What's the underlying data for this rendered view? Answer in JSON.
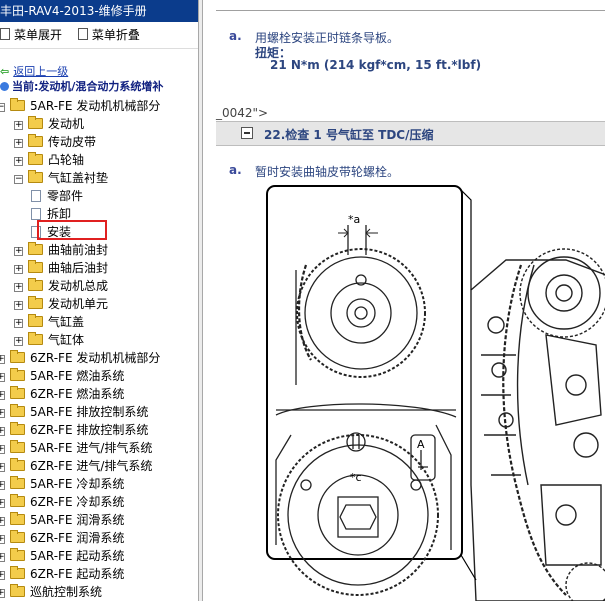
{
  "window_title": "丰田-RAV4-2013-维修手册",
  "toolbar": {
    "expand_label": "菜单展开",
    "collapse_label": "菜单折叠"
  },
  "nav": {
    "back_label": "返回上一级",
    "current_label": "当前:发动机/混合动力系统增补"
  },
  "tree": [
    {
      "label": "5AR-FE 发动机机械部分",
      "expander": "−"
    },
    {
      "label": "发动机",
      "expander": "+"
    },
    {
      "label": "传动皮带",
      "expander": "+"
    },
    {
      "label": "凸轮轴",
      "expander": "+"
    },
    {
      "label": "气缸盖衬垫",
      "expander": "−"
    },
    {
      "label": "零部件"
    },
    {
      "label": "拆卸"
    },
    {
      "label": "安装",
      "selected": true
    },
    {
      "label": "曲轴前油封",
      "expander": "+"
    },
    {
      "label": "曲轴后油封",
      "expander": "+"
    },
    {
      "label": "发动机总成",
      "expander": "+"
    },
    {
      "label": "发动机单元",
      "expander": "+"
    },
    {
      "label": "气缸盖",
      "expander": "+"
    },
    {
      "label": "气缸体",
      "expander": "+"
    },
    {
      "label": "6ZR-FE 发动机机械部分",
      "expander": "+"
    },
    {
      "label": "5AR-FE 燃油系统",
      "expander": "+"
    },
    {
      "label": "6ZR-FE 燃油系统",
      "expander": "+"
    },
    {
      "label": "5AR-FE 排放控制系统",
      "expander": "+"
    },
    {
      "label": "6ZR-FE 排放控制系统",
      "expander": "+"
    },
    {
      "label": "5AR-FE 进气/排气系统",
      "expander": "+"
    },
    {
      "label": "6ZR-FE 进气/排气系统",
      "expander": "+"
    },
    {
      "label": "5AR-FE 冷却系统",
      "expander": "+"
    },
    {
      "label": "6ZR-FE 冷却系统",
      "expander": "+"
    },
    {
      "label": "5AR-FE 润滑系统",
      "expander": "+"
    },
    {
      "label": "6ZR-FE 润滑系统",
      "expander": "+"
    },
    {
      "label": "5AR-FE 起动系统",
      "expander": "+"
    },
    {
      "label": "6ZR-FE 起动系统",
      "expander": "+"
    },
    {
      "label": "巡航控制系统",
      "expander": "+"
    }
  ],
  "content": {
    "step1_letter": "a.",
    "step1_text": "用螺栓安装正时链条导板。",
    "torque_label": "扭矩：",
    "torque_value": "21 N*m (214 kgf*cm, 15 ft.*lbf)",
    "anchor_text": "_0042\">",
    "section_title": "22.检查 1 号气缸至 TDC/压缩",
    "step2_letter": "a.",
    "step2_text": "暂时安装曲轴皮带轮螺栓。"
  },
  "figure": {
    "label_a": "*a",
    "label_c": "*c",
    "mark_A": "A"
  },
  "colors": {
    "title_bar": "#0b3c8c",
    "selection_outline": "#e02020",
    "text_blue": "#2d4680"
  }
}
